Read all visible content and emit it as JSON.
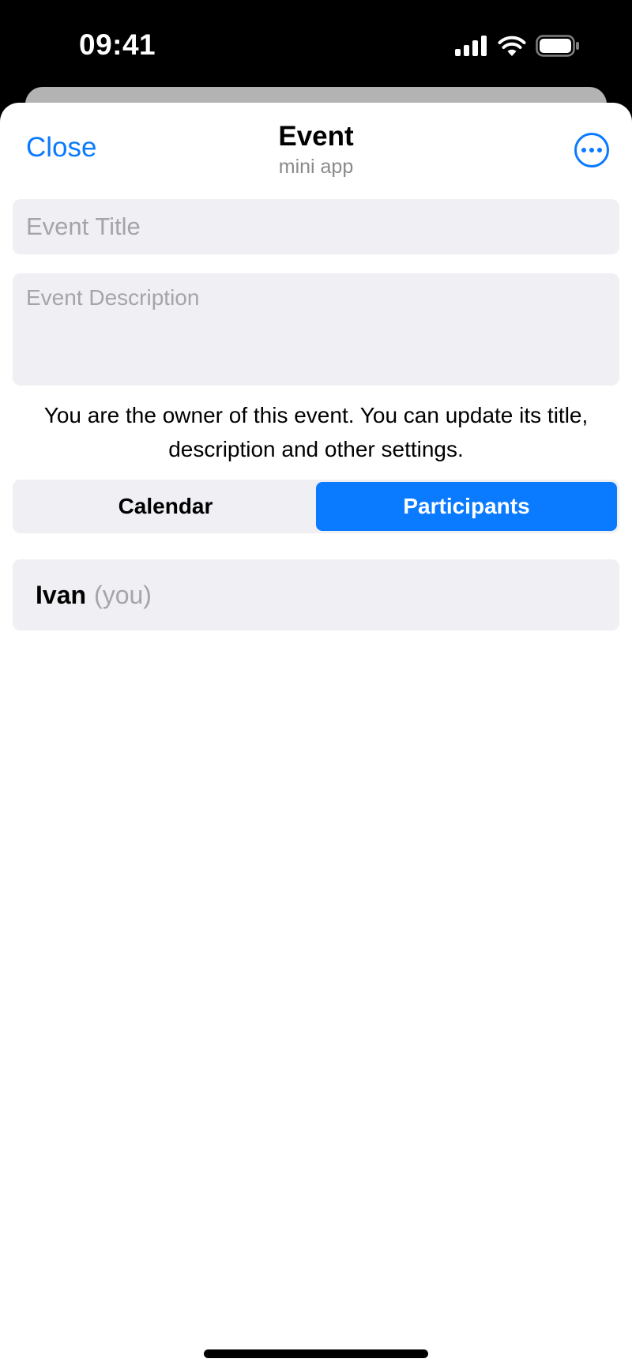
{
  "status_bar": {
    "time": "09:41",
    "icons": [
      "cellular-signal-icon",
      "wifi-icon",
      "battery-icon"
    ]
  },
  "nav": {
    "close_label": "Close",
    "title": "Event",
    "subtitle": "mini app",
    "more_icon": "ellipsis-circle-icon"
  },
  "form": {
    "title_placeholder": "Event Title",
    "title_value": "",
    "description_placeholder": "Event Description",
    "description_value": ""
  },
  "owner_note": "You are the owner of this event. You can update its title, description and other settings.",
  "tabs": [
    {
      "label": "Calendar",
      "selected": false
    },
    {
      "label": "Participants",
      "selected": true
    }
  ],
  "participants": [
    {
      "name": "Ivan",
      "tag": "(you)"
    }
  ],
  "colors": {
    "accent": "#0a7aff",
    "field_background": "#efeff4",
    "placeholder": "#a4a4a9"
  }
}
